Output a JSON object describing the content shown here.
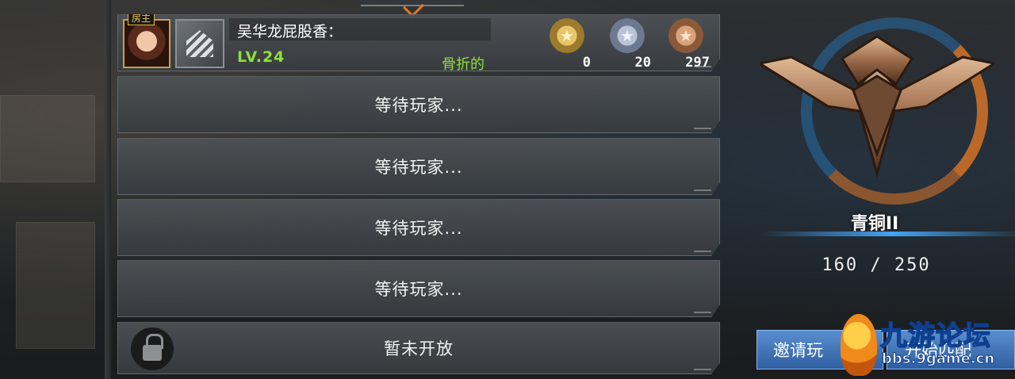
{
  "host_slot": {
    "host_tag": "房主",
    "player_name": "吴华龙屁股香：",
    "level": "LV.24",
    "guild": "骨折的",
    "medals": [
      {
        "name": "gold",
        "count": "0"
      },
      {
        "name": "silver",
        "count": "20"
      },
      {
        "name": "bronze",
        "count": "297"
      }
    ]
  },
  "slots": [
    {
      "label": "等待玩家..."
    },
    {
      "label": "等待玩家..."
    },
    {
      "label": "等待玩家..."
    },
    {
      "label": "等待玩家..."
    }
  ],
  "locked_slot": {
    "label": "暂未开放"
  },
  "rank": {
    "title": "青铜II",
    "progress_text": "160 / 250"
  },
  "buttons": {
    "invite": "邀请玩",
    "start": "开始匹配"
  },
  "watermark": {
    "brand": "九游论坛",
    "site": "bbs.9game.cn"
  },
  "colors": {
    "level_green": "#8fe03a",
    "button_blue": "#3f73b8",
    "gold_frame": "#c9a048"
  }
}
